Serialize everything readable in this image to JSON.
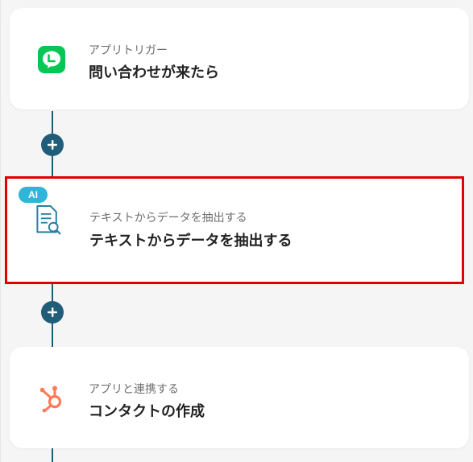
{
  "flow": {
    "steps": [
      {
        "subtitle": "アプリトリガー",
        "title": "問い合わせが来たら",
        "icon": "line-app-icon",
        "color": "#06c755"
      },
      {
        "badge": "AI",
        "subtitle": "テキストからデータを抽出する",
        "title": "テキストからデータを抽出する",
        "icon": "document-search-icon",
        "color": "#2a7fa0",
        "highlighted": true
      },
      {
        "subtitle": "アプリと連携する",
        "title": "コンタクトの作成",
        "icon": "hubspot-icon",
        "color": "#ff7a59"
      }
    ],
    "add_step_icon": "plus-icon",
    "connector_color": "#1f5d7a",
    "highlight_color": "#e00000"
  }
}
